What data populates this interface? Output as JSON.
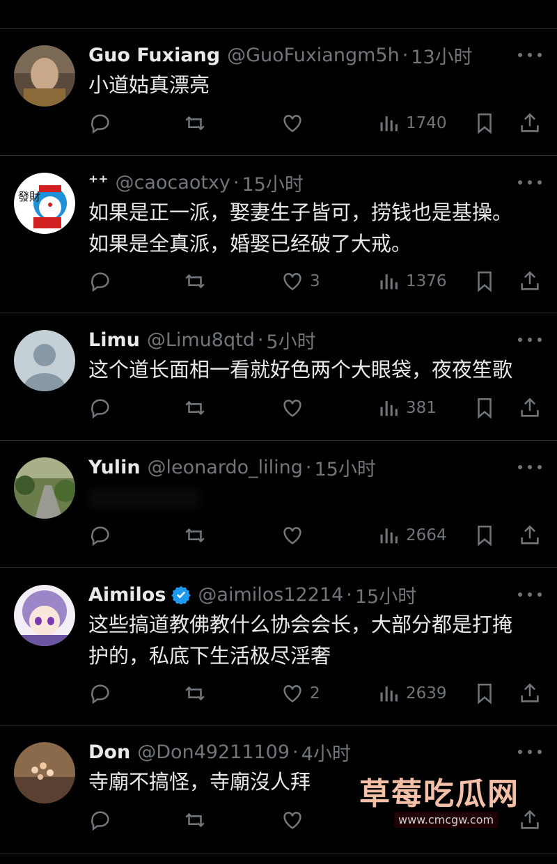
{
  "replies": [
    {
      "name": "Guo Fuxiang",
      "handle": "@GuoFuxiangm5h",
      "sep": "·",
      "time": "13小时",
      "lines": [
        "小道姑真漂亮"
      ],
      "reply": "",
      "retweet": "",
      "like": "",
      "views": "1740",
      "verified": false
    },
    {
      "name": "⁺⁺",
      "handle": "@caocaotxy",
      "sep": "·",
      "time": "15小时",
      "lines": [
        "如果是正一派，娶妻生子皆可，捞钱也是基操。",
        "如果是全真派，婚娶已经破了大戒。"
      ],
      "reply": "",
      "retweet": "",
      "like": "3",
      "views": "1376",
      "verified": false
    },
    {
      "name": "Limu",
      "handle": "@Limu8qtd",
      "sep": "·",
      "time": "5小时",
      "lines": [
        "这个道长面相一看就好色两个大眼袋，夜夜笙歌"
      ],
      "reply": "",
      "retweet": "",
      "like": "",
      "views": "381",
      "verified": false
    },
    {
      "name": "Yulin",
      "handle": "@leonardo_liling",
      "sep": "·",
      "time": "15小时",
      "lines": [],
      "reply": "",
      "retweet": "",
      "like": "",
      "views": "2664",
      "verified": false
    },
    {
      "name": "Aimilos",
      "handle": "@aimilos12214",
      "sep": "·",
      "time": "15小时",
      "lines": [
        "这些搞道教佛教什么协会会长，大部分都是打掩",
        "护的，私底下生活极尽淫奢"
      ],
      "reply": "",
      "retweet": "",
      "like": "2",
      "views": "2639",
      "verified": true
    },
    {
      "name": "Don",
      "handle": "@Don49211109",
      "sep": "·",
      "time": "4小时",
      "lines": [
        "寺廟不搞怪，寺廟沒人拜"
      ],
      "reply": "",
      "retweet": "",
      "like": "",
      "views": "",
      "verified": false
    }
  ],
  "avatar_text": {
    "r1": "發財"
  },
  "watermark": {
    "title": "草莓吃瓜网",
    "url": "www.cmcgw.com"
  },
  "colors": {
    "bg": "#000000",
    "text": "#e7e9ea",
    "muted": "#71767b",
    "divider": "#2f3336",
    "verified": "#1d9bf0"
  },
  "icons": [
    "reply-icon",
    "retweet-icon",
    "like-icon",
    "views-icon",
    "bookmark-icon",
    "share-icon",
    "more-icon",
    "verified-badge-icon"
  ]
}
